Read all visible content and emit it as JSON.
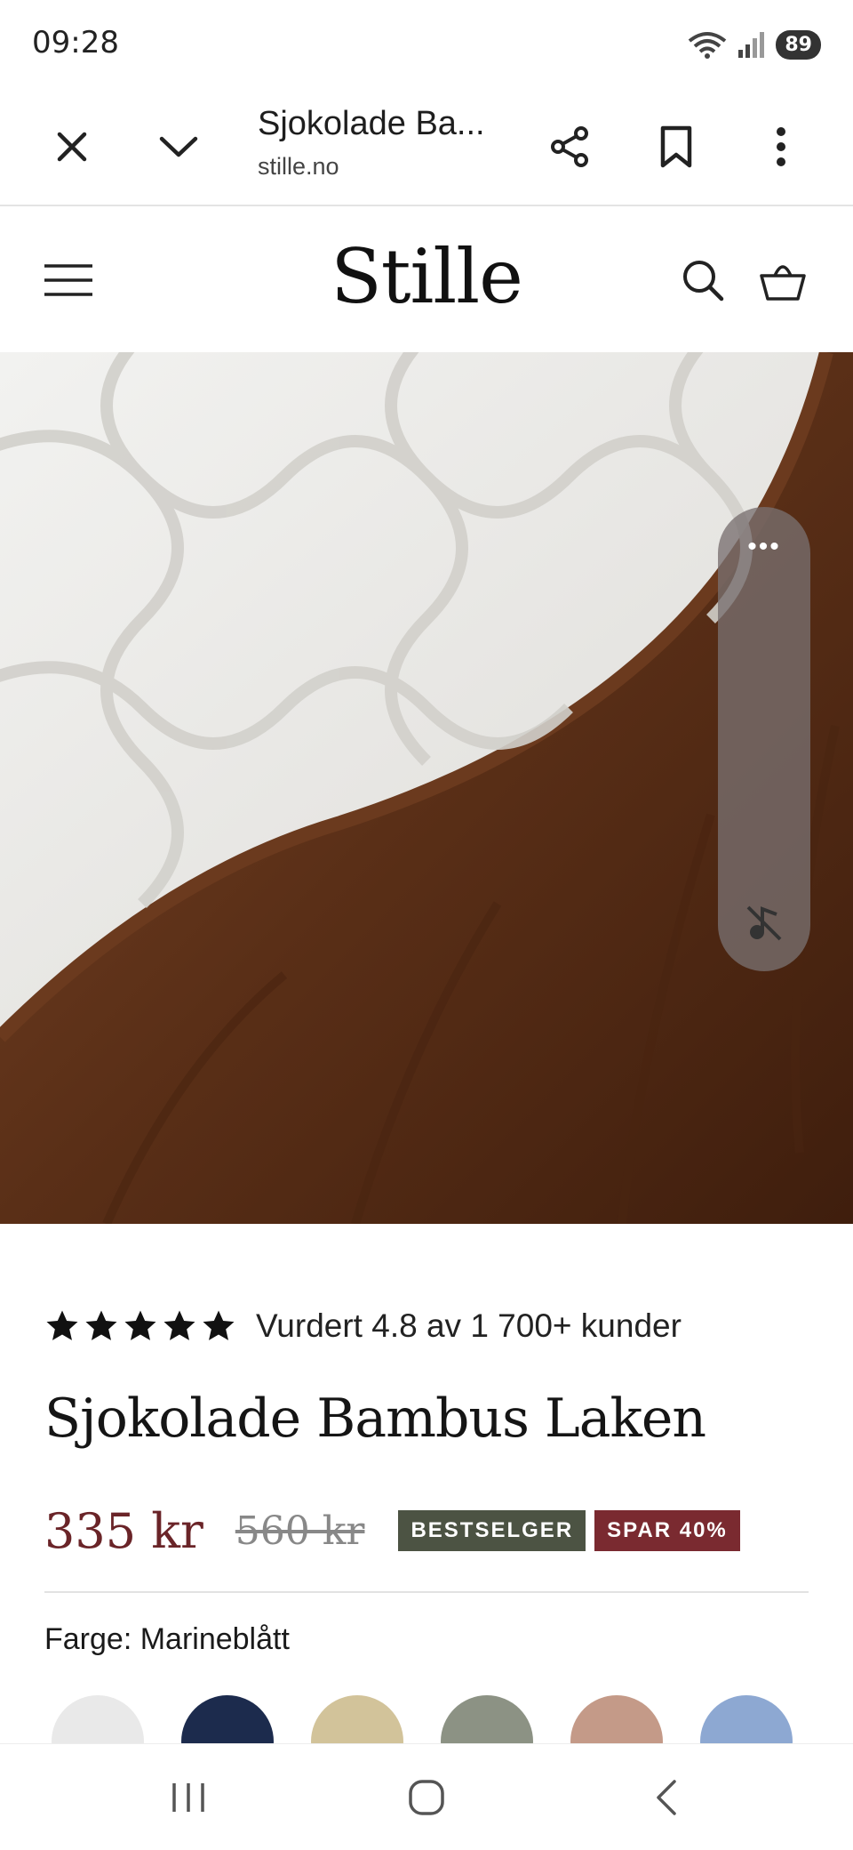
{
  "status_bar": {
    "time": "09:28",
    "battery": "89"
  },
  "browser": {
    "page_title": "Sjokolade Ba...",
    "url": "stille.no"
  },
  "site": {
    "logo": "Stille"
  },
  "product": {
    "rating_text": "Vurdert 4.8 av 1 700+ kunder",
    "stars": 5,
    "title": "Sjokolade Bambus Laken",
    "price_now": "335 kr",
    "price_old": "560 kr",
    "badge_bestseller": "BESTSELGER",
    "badge_discount": "SPAR 40%",
    "color_label": "Farge: Marineblått"
  },
  "hero_overlay": {
    "dots": "•••"
  },
  "colors": {
    "price_accent": "#6a2428",
    "badge_bestseller_bg": "#4c5343",
    "badge_discount_bg": "#7a2a30",
    "sheet_brown": "#5a2f17",
    "swatches": [
      "#e9e9e9",
      "#1c2b4d",
      "#d2c39a",
      "#8c9284",
      "#c49a88",
      "#8da8d2"
    ]
  }
}
